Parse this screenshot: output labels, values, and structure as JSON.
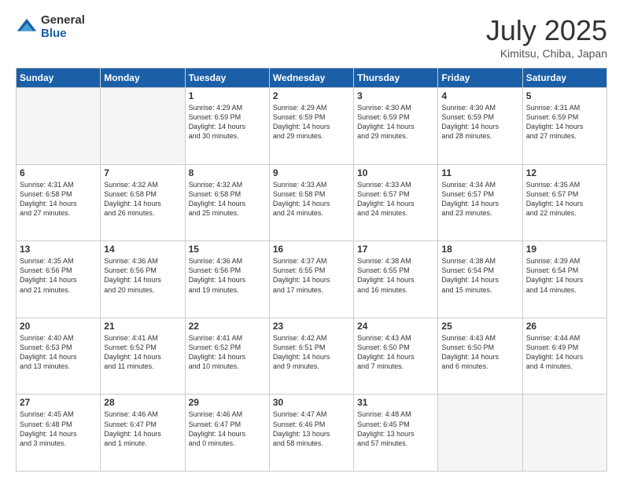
{
  "logo": {
    "general": "General",
    "blue": "Blue"
  },
  "title": "July 2025",
  "subtitle": "Kimitsu, Chiba, Japan",
  "headers": [
    "Sunday",
    "Monday",
    "Tuesday",
    "Wednesday",
    "Thursday",
    "Friday",
    "Saturday"
  ],
  "weeks": [
    [
      {
        "day": "",
        "info": ""
      },
      {
        "day": "",
        "info": ""
      },
      {
        "day": "1",
        "info": "Sunrise: 4:29 AM\nSunset: 6:59 PM\nDaylight: 14 hours\nand 30 minutes."
      },
      {
        "day": "2",
        "info": "Sunrise: 4:29 AM\nSunset: 6:59 PM\nDaylight: 14 hours\nand 29 minutes."
      },
      {
        "day": "3",
        "info": "Sunrise: 4:30 AM\nSunset: 6:59 PM\nDaylight: 14 hours\nand 29 minutes."
      },
      {
        "day": "4",
        "info": "Sunrise: 4:30 AM\nSunset: 6:59 PM\nDaylight: 14 hours\nand 28 minutes."
      },
      {
        "day": "5",
        "info": "Sunrise: 4:31 AM\nSunset: 6:59 PM\nDaylight: 14 hours\nand 27 minutes."
      }
    ],
    [
      {
        "day": "6",
        "info": "Sunrise: 4:31 AM\nSunset: 6:58 PM\nDaylight: 14 hours\nand 27 minutes."
      },
      {
        "day": "7",
        "info": "Sunrise: 4:32 AM\nSunset: 6:58 PM\nDaylight: 14 hours\nand 26 minutes."
      },
      {
        "day": "8",
        "info": "Sunrise: 4:32 AM\nSunset: 6:58 PM\nDaylight: 14 hours\nand 25 minutes."
      },
      {
        "day": "9",
        "info": "Sunrise: 4:33 AM\nSunset: 6:58 PM\nDaylight: 14 hours\nand 24 minutes."
      },
      {
        "day": "10",
        "info": "Sunrise: 4:33 AM\nSunset: 6:57 PM\nDaylight: 14 hours\nand 24 minutes."
      },
      {
        "day": "11",
        "info": "Sunrise: 4:34 AM\nSunset: 6:57 PM\nDaylight: 14 hours\nand 23 minutes."
      },
      {
        "day": "12",
        "info": "Sunrise: 4:35 AM\nSunset: 6:57 PM\nDaylight: 14 hours\nand 22 minutes."
      }
    ],
    [
      {
        "day": "13",
        "info": "Sunrise: 4:35 AM\nSunset: 6:56 PM\nDaylight: 14 hours\nand 21 minutes."
      },
      {
        "day": "14",
        "info": "Sunrise: 4:36 AM\nSunset: 6:56 PM\nDaylight: 14 hours\nand 20 minutes."
      },
      {
        "day": "15",
        "info": "Sunrise: 4:36 AM\nSunset: 6:56 PM\nDaylight: 14 hours\nand 19 minutes."
      },
      {
        "day": "16",
        "info": "Sunrise: 4:37 AM\nSunset: 6:55 PM\nDaylight: 14 hours\nand 17 minutes."
      },
      {
        "day": "17",
        "info": "Sunrise: 4:38 AM\nSunset: 6:55 PM\nDaylight: 14 hours\nand 16 minutes."
      },
      {
        "day": "18",
        "info": "Sunrise: 4:38 AM\nSunset: 6:54 PM\nDaylight: 14 hours\nand 15 minutes."
      },
      {
        "day": "19",
        "info": "Sunrise: 4:39 AM\nSunset: 6:54 PM\nDaylight: 14 hours\nand 14 minutes."
      }
    ],
    [
      {
        "day": "20",
        "info": "Sunrise: 4:40 AM\nSunset: 6:53 PM\nDaylight: 14 hours\nand 13 minutes."
      },
      {
        "day": "21",
        "info": "Sunrise: 4:41 AM\nSunset: 6:52 PM\nDaylight: 14 hours\nand 11 minutes."
      },
      {
        "day": "22",
        "info": "Sunrise: 4:41 AM\nSunset: 6:52 PM\nDaylight: 14 hours\nand 10 minutes."
      },
      {
        "day": "23",
        "info": "Sunrise: 4:42 AM\nSunset: 6:51 PM\nDaylight: 14 hours\nand 9 minutes."
      },
      {
        "day": "24",
        "info": "Sunrise: 4:43 AM\nSunset: 6:50 PM\nDaylight: 14 hours\nand 7 minutes."
      },
      {
        "day": "25",
        "info": "Sunrise: 4:43 AM\nSunset: 6:50 PM\nDaylight: 14 hours\nand 6 minutes."
      },
      {
        "day": "26",
        "info": "Sunrise: 4:44 AM\nSunset: 6:49 PM\nDaylight: 14 hours\nand 4 minutes."
      }
    ],
    [
      {
        "day": "27",
        "info": "Sunrise: 4:45 AM\nSunset: 6:48 PM\nDaylight: 14 hours\nand 3 minutes."
      },
      {
        "day": "28",
        "info": "Sunrise: 4:46 AM\nSunset: 6:47 PM\nDaylight: 14 hours\nand 1 minute."
      },
      {
        "day": "29",
        "info": "Sunrise: 4:46 AM\nSunset: 6:47 PM\nDaylight: 14 hours\nand 0 minutes."
      },
      {
        "day": "30",
        "info": "Sunrise: 4:47 AM\nSunset: 6:46 PM\nDaylight: 13 hours\nand 58 minutes."
      },
      {
        "day": "31",
        "info": "Sunrise: 4:48 AM\nSunset: 6:45 PM\nDaylight: 13 hours\nand 57 minutes."
      },
      {
        "day": "",
        "info": ""
      },
      {
        "day": "",
        "info": ""
      }
    ]
  ]
}
